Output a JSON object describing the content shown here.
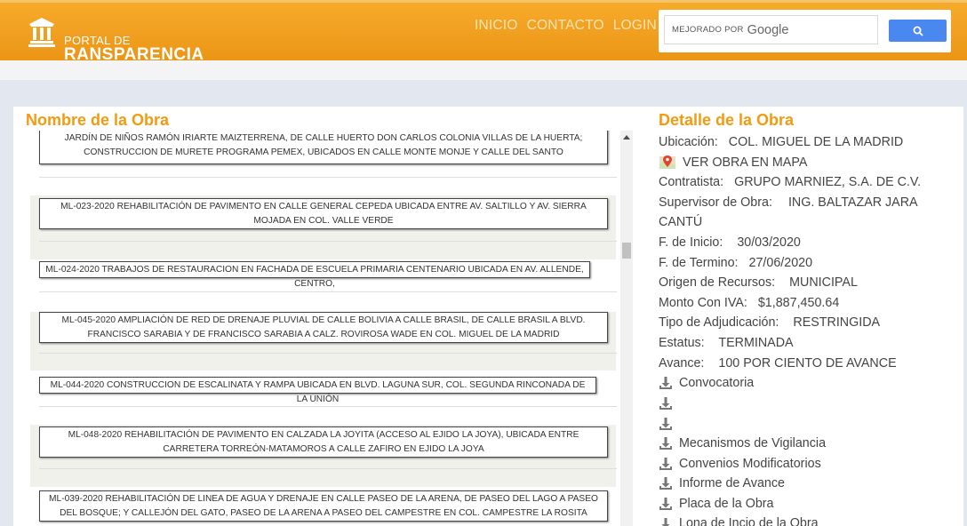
{
  "header": {
    "logo_small": "PORTAL DE",
    "logo_big": "RANSPARENCIA",
    "nav": [
      "INICIO",
      "CONTACTO",
      "LOGIN"
    ],
    "search_prefix": "MEJORADO POR",
    "search_brand": "Google"
  },
  "left": {
    "title": "Nombre de la Obra",
    "items": [
      {
        "text": "JARDÍN DE NIÑOS RAMÓN IRIARTE MAIZTERRENA, DE CALLE HUERTO DON CARLOS COLONIA VILLAS DE LA HUERTA; CONSTRUCCION DE MURETE PROGRAMA PEMEX, UBICADOS EN CALLE MONTE MONJE Y CALLE DEL SANTO"
      },
      {
        "text": "ML-023-2020 REHABILITACIÓN DE PAVIMENTO EN CALLE GENERAL CEPEDA UBICADA ENTRE AV. SALTILLO Y AV. SIERRA MOJADA EN COL. VALLE VERDE"
      },
      {
        "text": "ML-024-2020 TRABAJOS DE RESTAURACION EN FACHADA DE ESCUELA PRIMARIA CENTENARIO UBICADA EN AV. ALLENDE, CENTRO,"
      },
      {
        "text": "ML-045-2020 AMPLIACIÓN DE RED DE DRENAJE PLUVIAL DE CALLE BOLIVIA A CALLE BRASIL, DE CALLE BRASIL A BLVD. FRANCISCO SARABIA Y DE FRANCISCO SARABIA A CALZ. ROVIROSA WADE EN COL. MIGUEL DE LA MADRID"
      },
      {
        "text": "ML-044-2020 CONSTRUCCION DE ESCALINATA Y RAMPA UBICADA EN BLVD. LAGUNA SUR, COL. SEGUNDA RINCONADA DE LA UNIÓN"
      },
      {
        "text": "ML-048-2020 REHABILITACIÓN DE PAVIMENTO EN CALZADA LA JOYITA (ACCESO AL EJIDO LA JOYA), UBICADA ENTRE CARRETERA TORREÓN-MATAMOROS A CALLE ZAFIRO EN EJIDO LA JOYA"
      },
      {
        "text": "ML-039-2020 REHABILITACIÓN DE LINEA DE AGUA Y DRENAJE EN CALLE PASEO DE LA ARENA, DE PASEO DEL LAGO A PASEO DEL BOSQUE; Y CALLEJÓN DEL GATO, PASEO DE LA ARENA A PASEO DEL CAMPESTRE EN COL. CAMPESTRE LA ROSITA"
      }
    ]
  },
  "right": {
    "title": "Detalle de la Obra",
    "ubicacion_label": "Ubicación:",
    "ubicacion": "COL. MIGUEL DE LA MADRID",
    "map_link": "VER OBRA EN MAPA",
    "contratista_label": "Contratista:",
    "contratista": "GRUPO MARNIEZ, S.A. DE C.V.",
    "supervisor_label": "Supervisor de Obra:",
    "supervisor": "ING. BALTAZAR JARA CANTÚ",
    "inicio_label": "F. de Inicio:",
    "inicio": "30/03/2020",
    "termino_label": "F. de Termino:",
    "termino": "27/06/2020",
    "origen_label": "Origen de Recursos:",
    "origen": "MUNICIPAL",
    "monto_label": "Monto Con IVA:",
    "monto": "$1,887,450.64",
    "tipo_label": "Tipo de Adjudicación:",
    "tipo": "RESTRINGIDA",
    "estatus_label": "Estatus:",
    "estatus": "TERMINADA",
    "avance_label": "Avance:",
    "avance": "100 POR CIENTO DE AVANCE",
    "downloads": [
      "Convocatoria",
      "",
      "",
      "Mecanismos de Vigilancia",
      "Convenios Modificatorios",
      "Informe de Avance",
      "Placa de la Obra",
      "Lona de Incio de la Obra"
    ]
  }
}
